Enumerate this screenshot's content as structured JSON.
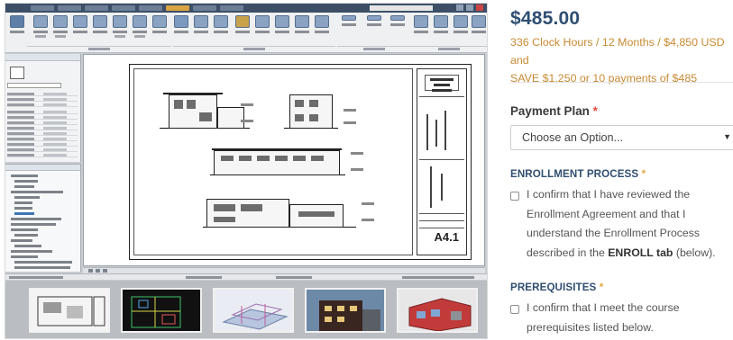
{
  "product": {
    "price": "$485.00",
    "details_line1": "336 Clock Hours / 12 Months / $4,850 USD and",
    "details_line2": "SAVE $1,250 or 10 payments of $485"
  },
  "payment_plan": {
    "label": "Payment Plan",
    "required_mark": "*",
    "selected_value": "Choose an Option...",
    "chevron": "▼"
  },
  "enrollment": {
    "title": "ENROLLMENT PROCESS",
    "required_mark": "*",
    "checkbox_text_before": "I confirm that I have reviewed the Enrollment Agreement and that I understand the Enrollment Process described in the ",
    "checkbox_text_bold": "ENROLL tab",
    "checkbox_text_after": " (below).",
    "checked": false
  },
  "prerequisites": {
    "title": "PREREQUISITES",
    "required_mark": "*",
    "checkbox_text": "I confirm that I meet the course prerequisites listed below.",
    "checked": false
  },
  "software_screenshot": {
    "sheet_number": "A4.1",
    "colors": {
      "accent_blue": "#2f4e72",
      "accent_gold": "#c98a32",
      "required_red": "#e04a3a"
    }
  }
}
